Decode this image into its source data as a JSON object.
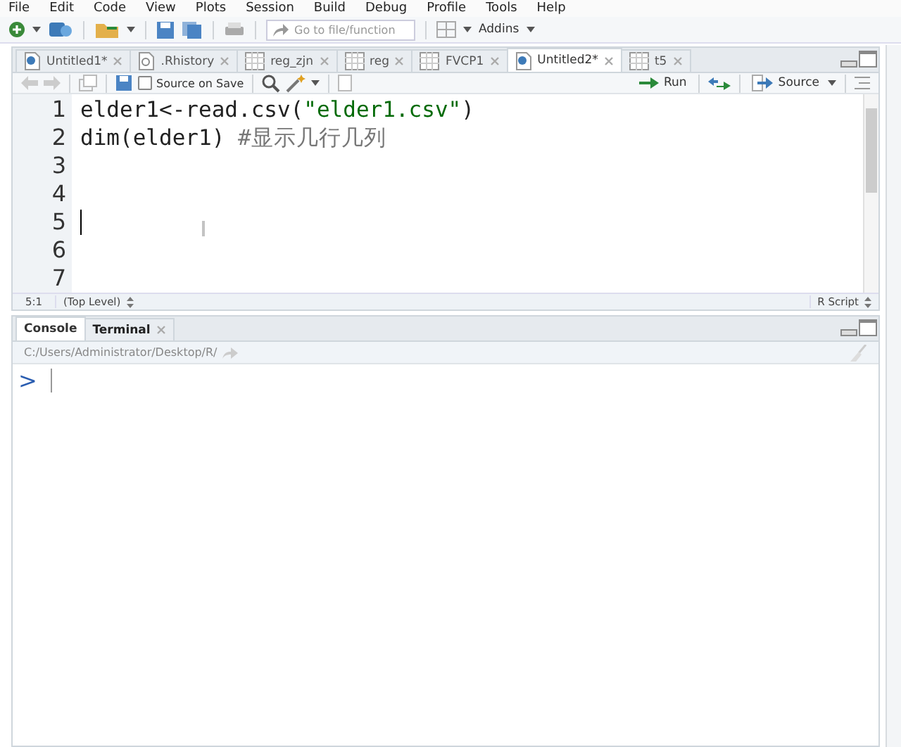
{
  "menu_bar": [
    "File",
    "Edit",
    "Code",
    "View",
    "Plots",
    "Session",
    "Build",
    "Debug",
    "Profile",
    "Tools",
    "Help"
  ],
  "toolbar": {
    "goto_placeholder": "Go to file/function",
    "addins": "Addins"
  },
  "editor_tabs": [
    {
      "label": "Untitled1*",
      "kind": "script",
      "selected": false
    },
    {
      "label": ".Rhistory",
      "kind": "history",
      "selected": false
    },
    {
      "label": "reg_zjn",
      "kind": "data",
      "selected": false
    },
    {
      "label": "reg",
      "kind": "data",
      "selected": false
    },
    {
      "label": "FVCP1",
      "kind": "data",
      "selected": false
    },
    {
      "label": "Untitled2*",
      "kind": "script",
      "selected": true
    },
    {
      "label": "t5",
      "kind": "data",
      "selected": false
    }
  ],
  "editor_toolbar": {
    "source_on_save": {
      "label": "Source on Save",
      "checked": false
    },
    "run": "Run",
    "source": "Source"
  },
  "editor": {
    "lines": [
      {
        "number": "1",
        "tokens": [
          {
            "kind": "plain",
            "text": "elder1<-read.csv("
          },
          {
            "kind": "string",
            "text": "\"elder1.csv\""
          },
          {
            "kind": "plain",
            "text": ")"
          }
        ]
      },
      {
        "number": "2",
        "tokens": [
          {
            "kind": "plain",
            "text": "dim(elder1) "
          },
          {
            "kind": "comment",
            "text": "#显示几行几列"
          }
        ]
      },
      {
        "number": "3"
      },
      {
        "number": "4"
      },
      {
        "number": "5",
        "cursor": true
      },
      {
        "number": "6"
      },
      {
        "number": "7"
      }
    ]
  },
  "editor_status": {
    "position": "5:1",
    "scope": "(Top Level)",
    "file_type": "R Script"
  },
  "console_tabs": [
    {
      "label": "Console",
      "selected": true,
      "closable": false
    },
    {
      "label": "Terminal",
      "selected": false,
      "closable": true
    }
  ],
  "console": {
    "path": "C:/Users/Administrator/Desktop/R/",
    "prompt": ">"
  }
}
